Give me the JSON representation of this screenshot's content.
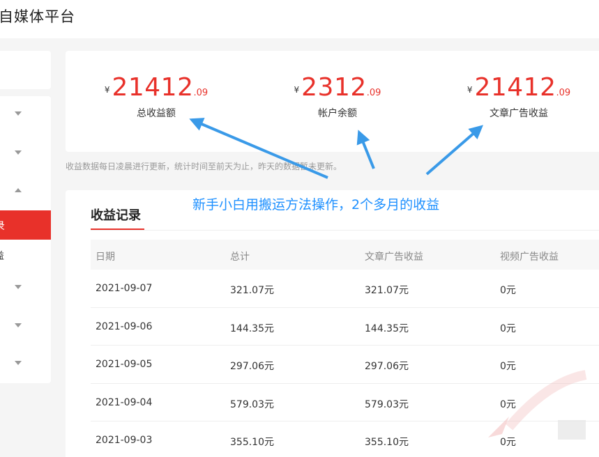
{
  "app": {
    "title": "自媒体平台"
  },
  "sidebar": {
    "active_label": "录",
    "sub_label": "益"
  },
  "stats": [
    {
      "currency": "¥",
      "integer": "21412",
      "decimal": ".09",
      "label": "总收益额"
    },
    {
      "currency": "¥",
      "integer": "2312",
      "decimal": ".09",
      "label": "帐户余额"
    },
    {
      "currency": "¥",
      "integer": "21412",
      "decimal": ".09",
      "label": "文章广告收益"
    }
  ],
  "note": "收益数据每日凌晨进行更新，统计时间至前天为止，昨天的数据暂未更新。",
  "records": {
    "title": "收益记录",
    "columns": [
      "日期",
      "总计",
      "文章广告收益",
      "视频广告收益"
    ],
    "rows": [
      [
        "2021-09-07",
        "321.07元",
        "321.07元",
        "0元"
      ],
      [
        "2021-09-06",
        "144.35元",
        "144.35元",
        "0元"
      ],
      [
        "2021-09-05",
        "297.06元",
        "297.06元",
        "0元"
      ],
      [
        "2021-09-04",
        "579.03元",
        "579.03元",
        "0元"
      ],
      [
        "2021-09-03",
        "355.10元",
        "355.10元",
        "0元"
      ]
    ]
  },
  "annotation": {
    "text": "新手小白用搬运方法操作，2个多月的收益",
    "color": "#1e90ff"
  },
  "colors": {
    "accent": "#e8312a"
  }
}
